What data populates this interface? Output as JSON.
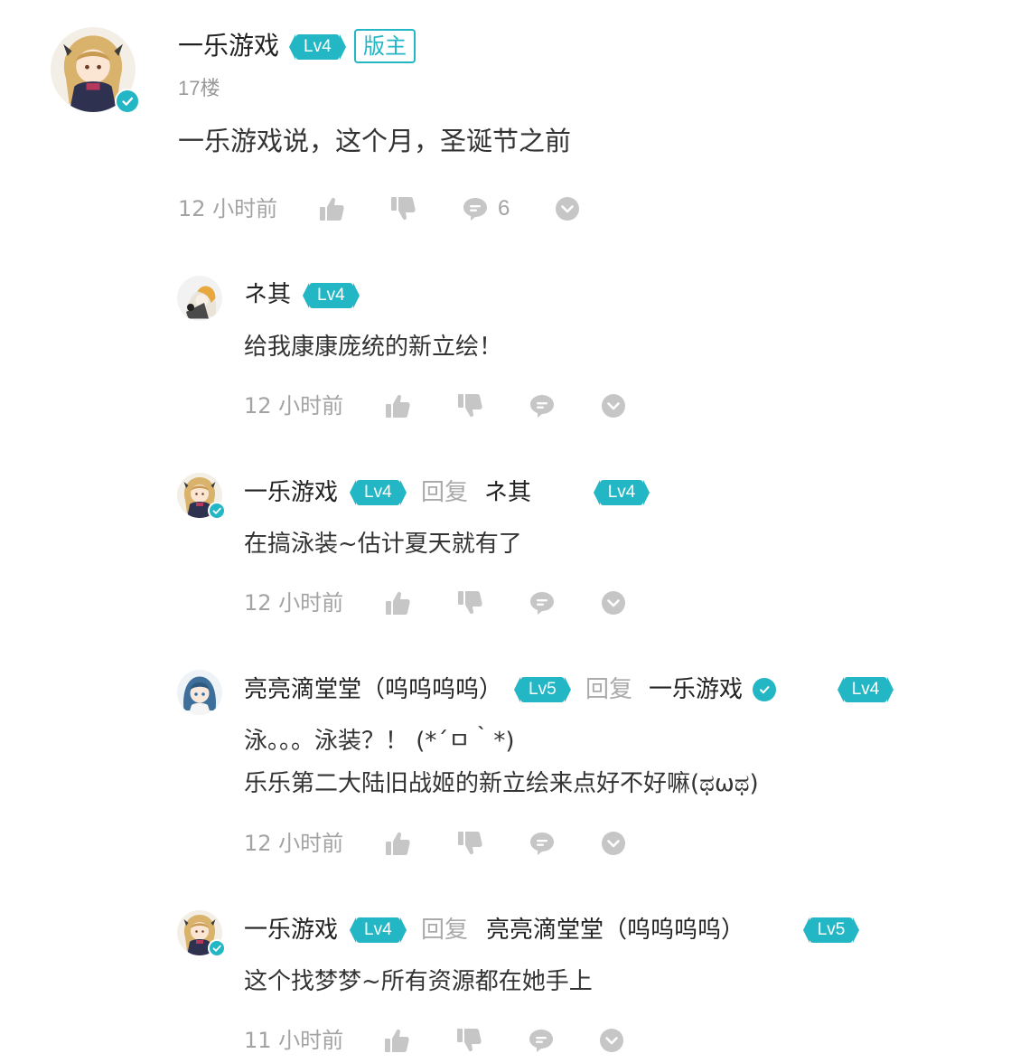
{
  "main_post": {
    "author": "一乐游戏",
    "level": "Lv4",
    "role_badge": "版主",
    "floor": "17楼",
    "content": "一乐游戏说，这个月，圣诞节之前",
    "time": "12 小时前",
    "reply_count": "6",
    "icons": [
      "thumbs-up-icon",
      "thumbs-down-icon",
      "comment-icon",
      "more-chevron-icon"
    ]
  },
  "replies": [
    {
      "author": "ネ其",
      "level": "Lv4",
      "content": "给我康康庞统的新立绘！",
      "time": "12 小时前"
    },
    {
      "author": "一乐游戏",
      "level": "Lv4",
      "reply_word": "回复",
      "reply_to": "ネ其",
      "reply_to_level": "Lv4",
      "content": "在搞泳装~估计夏天就有了",
      "time": "12 小时前"
    },
    {
      "author": "亮亮滴堂堂（呜呜呜呜）",
      "level": "Lv5",
      "reply_word": "回复",
      "reply_to": "一乐游戏",
      "reply_to_level": "Lv4",
      "content_line1": "泳。。。泳装？！ (*´ㅁ｀*)",
      "content_line2": "乐乐第二大陆旧战姬的新立绘来点好不好嘛(ಥωಥ)",
      "time": "12 小时前"
    },
    {
      "author": "一乐游戏",
      "level": "Lv4",
      "reply_word": "回复",
      "reply_to": "亮亮滴堂堂（呜呜呜呜）",
      "reply_to_level": "Lv5",
      "content": "这个找梦梦~所有资源都在她手上",
      "time": "11 小时前"
    }
  ],
  "colors": {
    "accent": "#23b6c4",
    "text": "#333333",
    "muted": "#a3a3a3",
    "icon": "#c4c4c4"
  }
}
